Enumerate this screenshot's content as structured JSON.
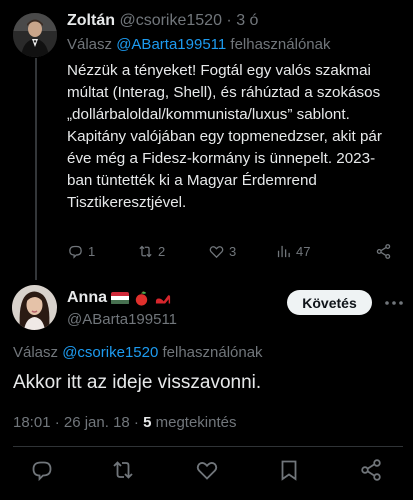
{
  "colors": {
    "background": "#000000",
    "text": "#e7e9ea",
    "muted": "#71767b",
    "link": "#1d9bf0",
    "follow_bg": "#eff3f4"
  },
  "tweet1": {
    "author_name": "Zoltán",
    "handle": "@csorike1520",
    "separator": "·",
    "time": "3 ó",
    "reply_prefix": "Válasz",
    "reply_mention": "@ABarta199511",
    "reply_suffix": "felhasználónak",
    "body": "Nézzük a tényeket! Fogtál egy valós szakmai múltat (Interag, Shell), és ráhúztad a szokásos „dollárbaloldal/kommunista/luxus” sablont. Kapitány valójában egy topmenedzser, akit pár éve még a Fidesz-kormány is ünnepelt. 2023-ban tüntették ki a Magyar Érdemrend Tisztikeresztjével.",
    "actions": {
      "reply": {
        "icon": "reply-icon",
        "count": "1"
      },
      "retweet": {
        "icon": "retweet-icon",
        "count": "2"
      },
      "like": {
        "icon": "heart-icon",
        "count": "3"
      },
      "views": {
        "icon": "views-icon",
        "count": "47"
      },
      "share": {
        "icon": "share-icon"
      }
    }
  },
  "tweet2": {
    "author_name": "Anna",
    "name_emojis": [
      "hungarian-flag-icon",
      "apple-icon",
      "high-heel-icon"
    ],
    "handle": "@ABarta199511",
    "follow_label": "Követés",
    "more_icon": "more-icon",
    "reply_prefix": "Válasz",
    "reply_mention": "@csorike1520",
    "reply_suffix": "felhasználónak",
    "body": "Akkor itt az ideje visszavonni.",
    "timestamp": "18:01 · 26 jan. 18 ·",
    "views_count": "5",
    "views_label": "megtekintés",
    "actions": [
      "reply-icon",
      "retweet-icon",
      "heart-icon",
      "bookmark-icon",
      "share-icon"
    ]
  }
}
